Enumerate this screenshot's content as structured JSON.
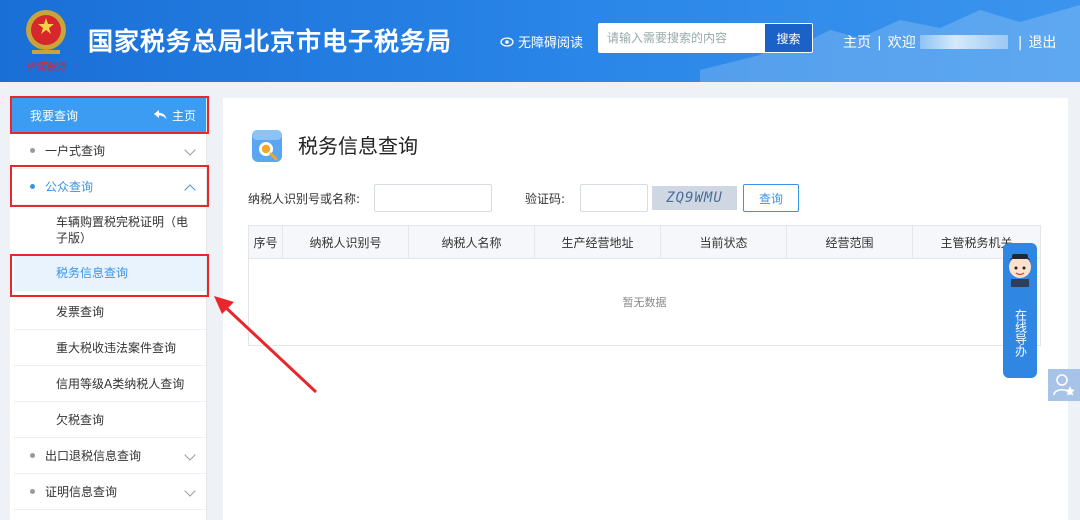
{
  "header": {
    "title": "国家税务总局北京市电子税务局",
    "accessibility": "无障碍阅读",
    "search_placeholder": "请输入需要搜索的内容",
    "search_button": "搜索",
    "home": "主页",
    "welcome": "欢迎",
    "logout": "退出",
    "separator": "|",
    "emblem_text": "中国税务"
  },
  "sidebar": {
    "header_label": "我要查询",
    "header_home": "主页",
    "items": [
      {
        "label": "一户式查询"
      },
      {
        "label": "公众查询"
      },
      {
        "label": "出口退税信息查询"
      },
      {
        "label": "证明信息查询"
      }
    ],
    "sub_items": [
      {
        "label": "车辆购置税完税证明（电子版）"
      },
      {
        "label": "税务信息查询"
      },
      {
        "label": "发票查询"
      },
      {
        "label": "重大税收违法案件查询"
      },
      {
        "label": "信用等级A类纳税人查询"
      },
      {
        "label": "欠税查询"
      }
    ]
  },
  "main": {
    "title": "税务信息查询",
    "taxpayer_label": "纳税人识别号或名称:",
    "captcha_label": "验证码:",
    "captcha_text": "ZQ9WMU",
    "query_button": "查询",
    "columns": [
      "序号",
      "纳税人识别号",
      "纳税人名称",
      "生产经营地址",
      "当前状态",
      "经营范围",
      "主管税务机关"
    ],
    "empty_text": "暂无数据"
  },
  "guide": {
    "text": "在线导办"
  },
  "colors": {
    "header_blue": "#2a86e8",
    "accent": "#3a93e8",
    "annotation_red": "#e8262b"
  }
}
